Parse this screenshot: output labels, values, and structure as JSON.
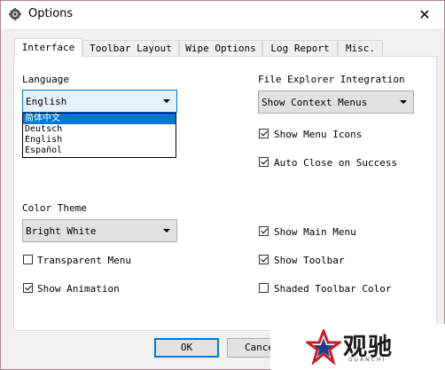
{
  "window": {
    "title": "Options",
    "close_glyph": "✕",
    "icon": "app-gear-icon"
  },
  "tabs": [
    {
      "label": "Interface",
      "active": true
    },
    {
      "label": "Toolbar Layout",
      "active": false
    },
    {
      "label": "Wipe Options",
      "active": false
    },
    {
      "label": "Log Report",
      "active": false
    },
    {
      "label": "Misc.",
      "active": false
    }
  ],
  "language": {
    "label": "Language",
    "selected": "English",
    "options": [
      "简体中文",
      "Deutsch",
      "English",
      "Español"
    ],
    "highlighted_option": "简体中文"
  },
  "file_explorer": {
    "label": "File Explorer Integration",
    "selected": "Show Context Menus"
  },
  "color_theme": {
    "label": "Color Theme",
    "selected": "Bright White"
  },
  "checkboxes": {
    "show_menu_icons": {
      "label": "Show Menu Icons",
      "checked": true
    },
    "auto_close": {
      "label": "Auto Close on Success",
      "checked": true
    },
    "show_main_menu": {
      "label": "Show Main Menu",
      "checked": true
    },
    "transparent_menu": {
      "label": "Transparent Menu",
      "checked": false
    },
    "show_toolbar": {
      "label": "Show Toolbar",
      "checked": true
    },
    "show_animation": {
      "label": "Show Animation",
      "checked": true
    },
    "shaded_toolbar": {
      "label": "Shaded Toolbar Color",
      "checked": false
    }
  },
  "buttons": {
    "ok": "OK",
    "cancel": "Cance"
  },
  "watermark": {
    "text": "观驰",
    "sub": "GUANCHI"
  },
  "colors": {
    "accent": "#0078d7",
    "window_border": "#b4848e",
    "panel_bg": "#ffffff",
    "dialog_bg": "#f0f0f0"
  }
}
